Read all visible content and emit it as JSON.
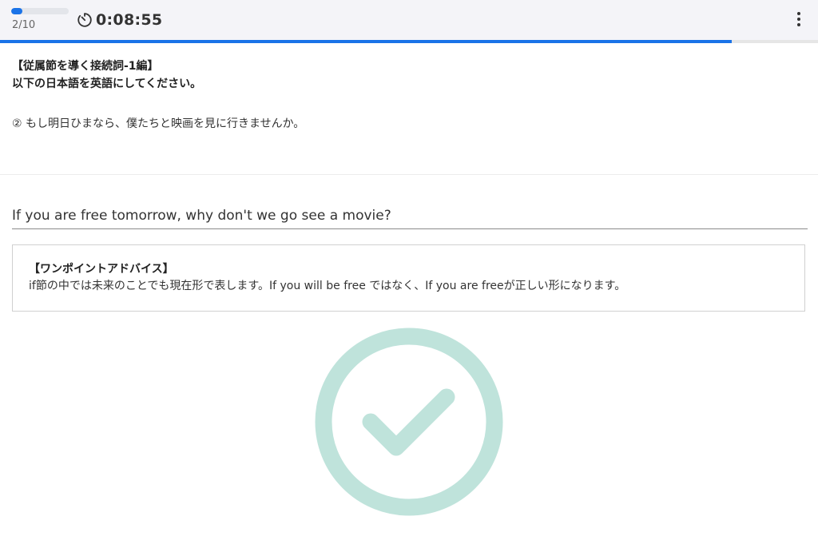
{
  "header": {
    "progress_fraction": 0.2,
    "counter": "2/10",
    "timer_icon": "timer-icon",
    "timer": "0:08:55",
    "menu_icon": "more-vertical-icon"
  },
  "quiz_progress_fraction": 0.895,
  "question": {
    "heading": "【従属節を導く接続詞-1編】",
    "instruction": "以下の日本語を英語にしてください。",
    "text": "② もし明日ひまなら、僕たちと映画を見に行きませんか。"
  },
  "answer": {
    "value": "If you are free tomorrow, why don't we go see a movie?"
  },
  "advice": {
    "title": "【ワンポイントアドバイス】",
    "text": "if節の中では未来のことでも現在形で表します。If you will be free ではなく、If you are freeが正しい形になります。"
  },
  "result": {
    "icon": "check-circle-icon",
    "status": "correct",
    "color": "#bfe3db"
  },
  "colors": {
    "accent": "#1a73e8",
    "header_bg": "#f4f4f8"
  }
}
